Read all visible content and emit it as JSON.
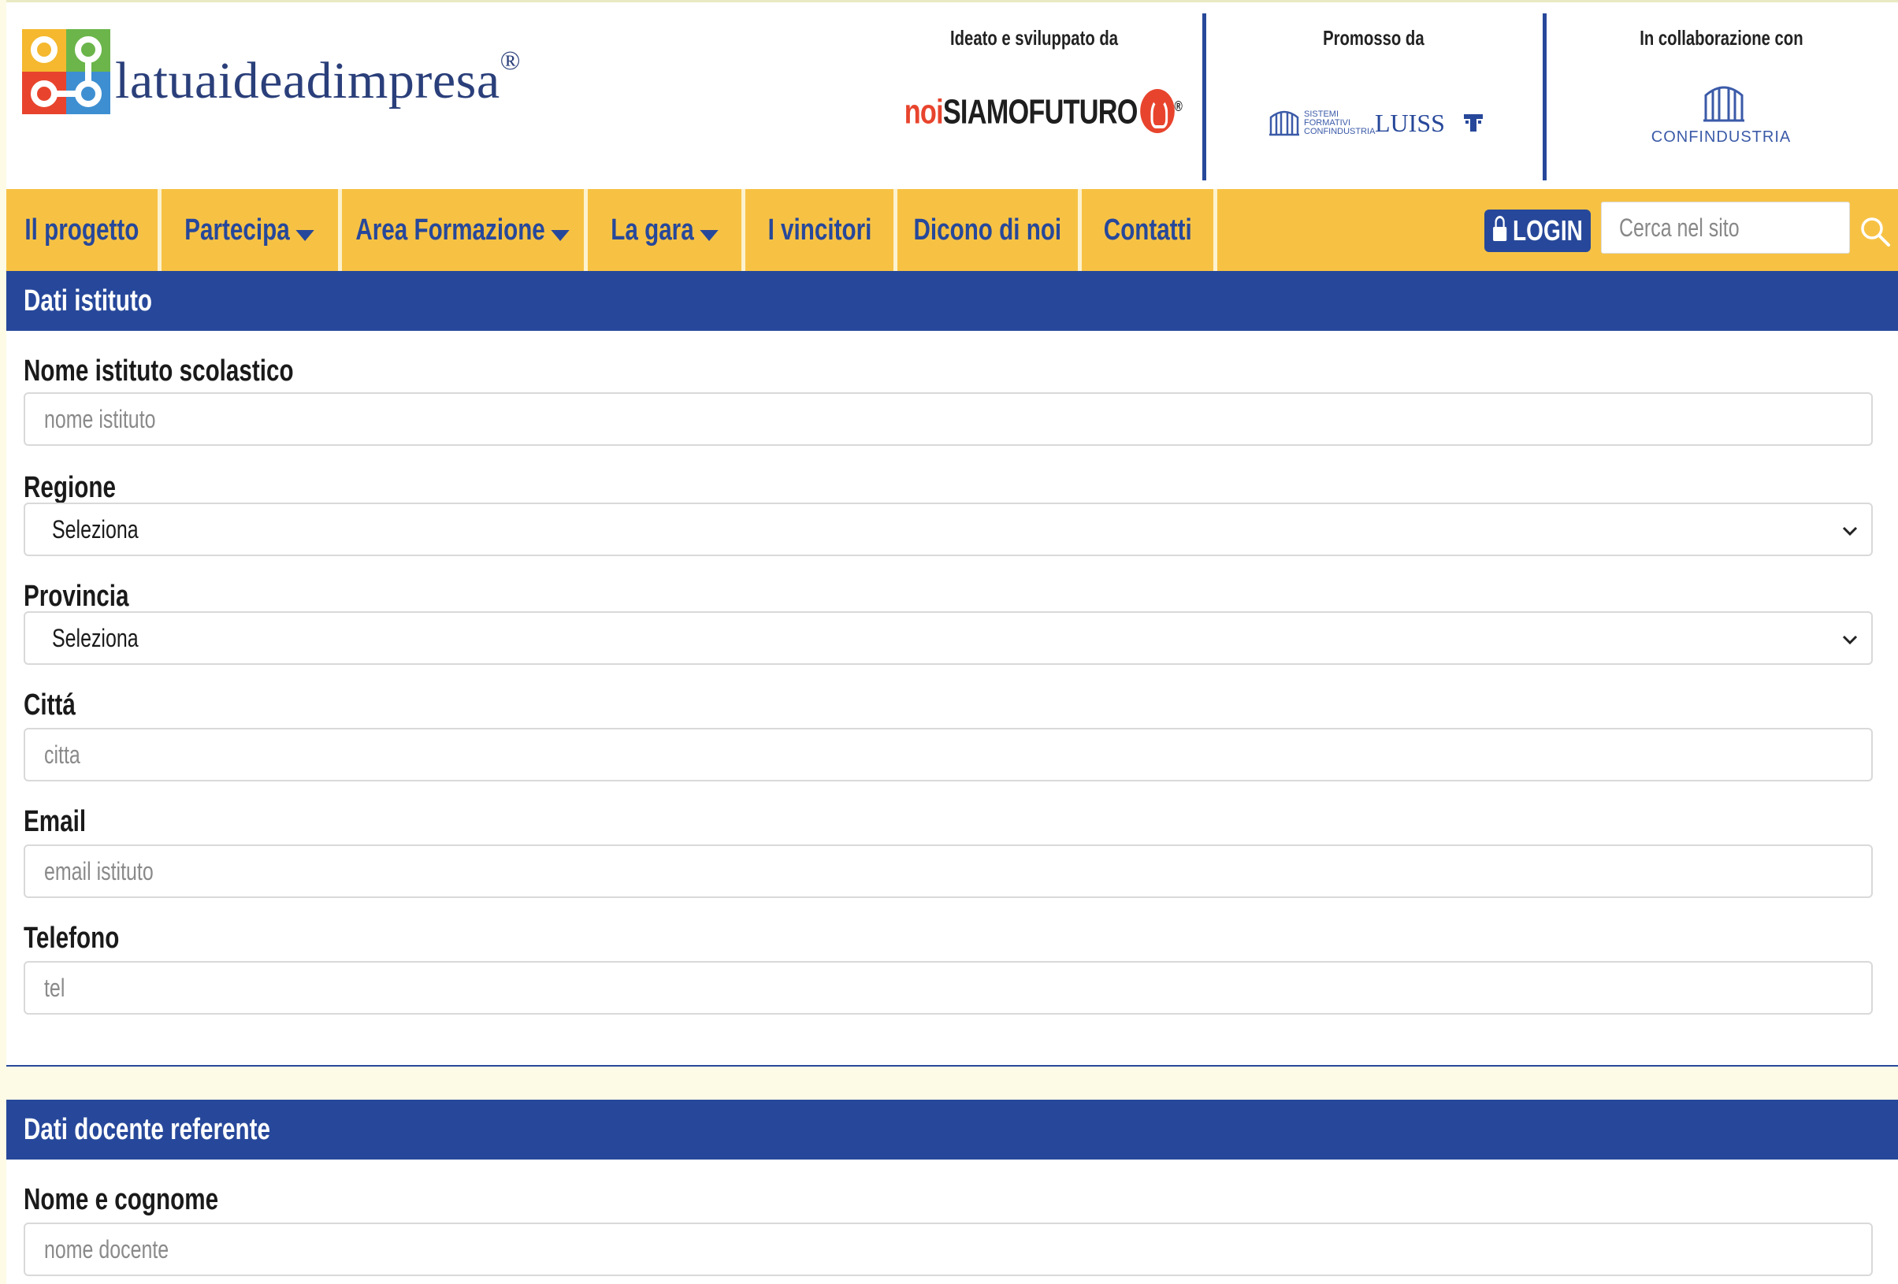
{
  "brand": {
    "name": "latuaideadimpresa",
    "registered": "®"
  },
  "partners": {
    "developed_label": "Ideato e sviluppato da",
    "developed_noi": "noi",
    "developed_rest": "SIAMOFUTURO",
    "developed_reg": "®",
    "promoted_label": "Promosso da",
    "promoted_sfc": "SISTEMI FORMATIVI CONFINDUSTRIA",
    "promoted_luiss": "LUISS",
    "collab_label": "In collaborazione con",
    "collab_name": "CONFINDUSTRIA"
  },
  "nav": {
    "items": [
      {
        "label": "Il progetto",
        "dropdown": false
      },
      {
        "label": "Partecipa",
        "dropdown": true
      },
      {
        "label": "Area Formazione",
        "dropdown": true
      },
      {
        "label": "La gara",
        "dropdown": true
      },
      {
        "label": "I vincitori",
        "dropdown": false
      },
      {
        "label": "Dicono di noi",
        "dropdown": false
      },
      {
        "label": "Contatti",
        "dropdown": false
      }
    ],
    "login_label": "LOGIN",
    "search_placeholder": "Cerca nel sito"
  },
  "colors": {
    "nav_bg": "#f7c244",
    "primary": "#27489a",
    "accent": "#e8442d"
  },
  "form": {
    "istituto": {
      "title": "Dati istituto",
      "fields": [
        {
          "label": "Nome istituto scolastico",
          "placeholder": "nome istituto",
          "type": "text"
        },
        {
          "label": "Regione",
          "value": "Seleziona",
          "type": "select"
        },
        {
          "label": "Provincia",
          "value": "Seleziona",
          "type": "select"
        },
        {
          "label": "Cittá",
          "placeholder": "citta",
          "type": "text"
        },
        {
          "label": "Email",
          "placeholder": "email istituto",
          "type": "text"
        },
        {
          "label": "Telefono",
          "placeholder": "tel",
          "type": "text"
        }
      ]
    },
    "docente": {
      "title": "Dati docente referente",
      "fields": [
        {
          "label": "Nome e cognome",
          "placeholder": "nome docente",
          "type": "text"
        }
      ]
    }
  }
}
